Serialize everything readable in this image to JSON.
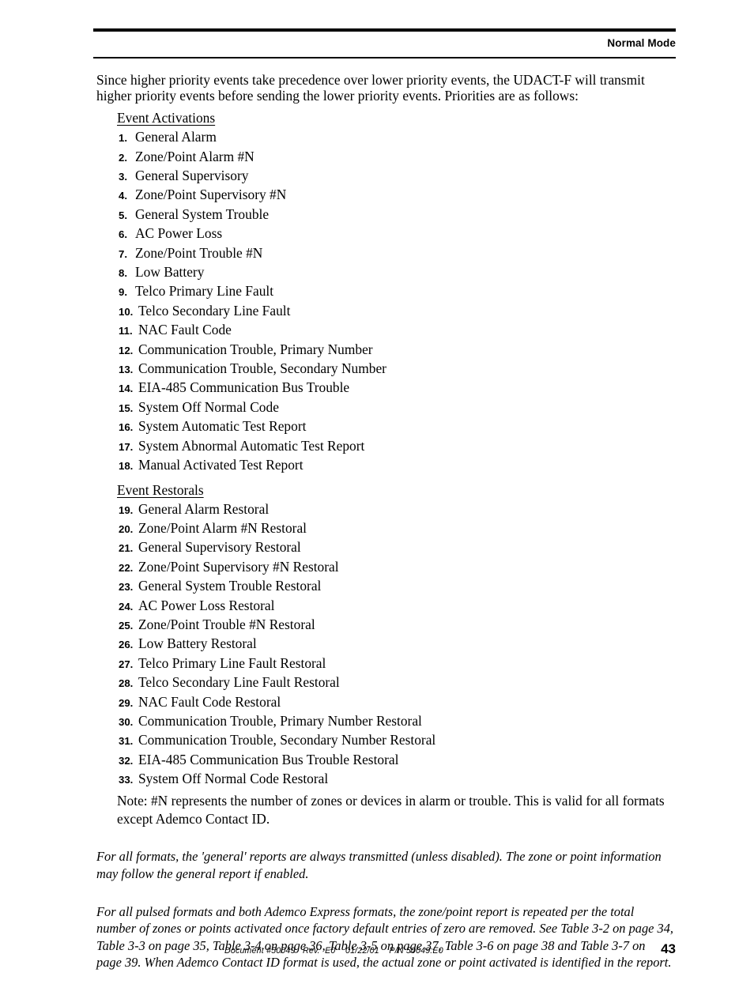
{
  "header": {
    "title": "Normal Mode"
  },
  "intro": "Since higher priority events take precedence over lower priority events, the UDACT-F will transmit higher priority events before sending the lower priority events.  Priorities are as follows:",
  "sections": {
    "activations_label": "Event Activations",
    "restorals_label": "Event Restorals"
  },
  "activations": [
    {
      "num": "1.",
      "text": "General Alarm"
    },
    {
      "num": "2.",
      "text": "Zone/Point Alarm #N"
    },
    {
      "num": "3.",
      "text": "General Supervisory"
    },
    {
      "num": "4.",
      "text": "Zone/Point Supervisory #N"
    },
    {
      "num": "5.",
      "text": "General System Trouble"
    },
    {
      "num": "6.",
      "text": "AC Power Loss"
    },
    {
      "num": "7.",
      "text": "Zone/Point Trouble #N"
    },
    {
      "num": "8.",
      "text": "Low Battery"
    },
    {
      "num": "9.",
      "text": "Telco Primary Line Fault"
    },
    {
      "num": "10.",
      "text": "Telco Secondary Line Fault"
    },
    {
      "num": "11.",
      "text": "NAC Fault Code"
    },
    {
      "num": "12.",
      "text": "Communication Trouble, Primary Number"
    },
    {
      "num": "13.",
      "text": "Communication Trouble, Secondary Number"
    },
    {
      "num": "14.",
      "text": "EIA-485 Communication Bus Trouble"
    },
    {
      "num": "15.",
      "text": "System Off Normal Code"
    },
    {
      "num": "16.",
      "text": "System Automatic Test Report"
    },
    {
      "num": "17.",
      "text": "System Abnormal Automatic Test Report"
    },
    {
      "num": "18.",
      "text": "Manual Activated Test Report"
    }
  ],
  "restorals": [
    {
      "num": "19.",
      "text": "General Alarm Restoral"
    },
    {
      "num": "20.",
      "text": "Zone/Point Alarm #N Restoral"
    },
    {
      "num": "21.",
      "text": "General Supervisory Restoral"
    },
    {
      "num": "22.",
      "text": "Zone/Point Supervisory #N Restoral"
    },
    {
      "num": "23.",
      "text": "General System Trouble Restoral"
    },
    {
      "num": "24.",
      "text": "AC Power Loss Restoral"
    },
    {
      "num": "25.",
      "text": "Zone/Point Trouble #N Restoral"
    },
    {
      "num": "26.",
      "text": "Low Battery Restoral"
    },
    {
      "num": "27.",
      "text": "Telco Primary Line Fault Restoral"
    },
    {
      "num": "28.",
      "text": "Telco Secondary Line Fault Restoral"
    },
    {
      "num": "29.",
      "text": "NAC Fault Code Restoral"
    },
    {
      "num": "30.",
      "text": "Communication Trouble, Primary Number Restoral"
    },
    {
      "num": "31.",
      "text": "Communication Trouble, Secondary Number Restoral"
    },
    {
      "num": "32.",
      "text": "EIA-485 Communication Bus Trouble Restoral"
    },
    {
      "num": "33.",
      "text": "System Off Normal Code Restoral"
    }
  ],
  "note": "Note: #N represents the number of zones or devices in alarm or trouble.  This is valid for all formats except Ademco Contact ID.",
  "italic_paragraphs": [
    "For all formats, the 'general' reports are always transmitted (unless disabled).  The zone or point information may follow the general report if enabled.",
    "For all pulsed formats and both Ademco Express formats, the zone/point report is repeated per the total number of zones or points activated once factory default entries of zero are removed.  See Table 3-2 on page 34, Table 3-3 on page 35, Table 3-4 on page 36, Table 3-5 on page 37, Table 3-6 on page 38 and Table 3-7 on page 39.  When Ademco Contact ID format is used, the actual zone or point activated is identified in the report."
  ],
  "footer": {
    "document_info": "Document #50049   Rev.  E0    01/22/01    P/N 50049:E0",
    "page_number": "43"
  }
}
